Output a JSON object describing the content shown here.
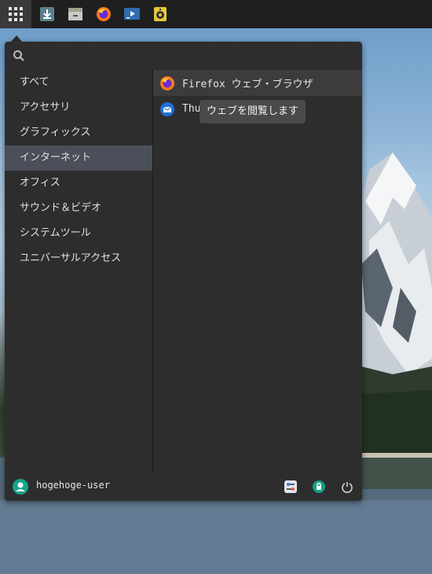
{
  "panel": {
    "launchers": [
      {
        "icon": "apps-grid-icon"
      },
      {
        "icon": "downloader-icon"
      },
      {
        "icon": "archive-manager-icon"
      },
      {
        "icon": "firefox-icon"
      },
      {
        "icon": "media-player-icon"
      },
      {
        "icon": "speaker-icon"
      }
    ]
  },
  "search": {
    "placeholder": "",
    "value": ""
  },
  "categories": [
    {
      "label": "すべて"
    },
    {
      "label": "アクセサリ"
    },
    {
      "label": "グラフィックス"
    },
    {
      "label": "インターネット",
      "active": true
    },
    {
      "label": "オフィス"
    },
    {
      "label": "サウンド＆ビデオ"
    },
    {
      "label": "システムツール"
    },
    {
      "label": "ユニバーサルアクセス"
    }
  ],
  "apps": [
    {
      "label": "Firefox ウェブ・ブラウザ",
      "icon": "firefox-icon",
      "active": true
    },
    {
      "label": "Thu",
      "icon": "thunderbird-icon"
    }
  ],
  "tooltip": {
    "text": "ウェブを閲覧します"
  },
  "footer": {
    "username": "hogehoge-user",
    "buttons": [
      {
        "icon": "settings-icon"
      },
      {
        "icon": "lock-screen-icon"
      },
      {
        "icon": "power-icon"
      }
    ]
  },
  "colors": {
    "menu_bg": "#2d2d2d",
    "selection": "#4b4f59",
    "panel_bg": "#1f1f1f",
    "avatar": "#17a38a"
  }
}
